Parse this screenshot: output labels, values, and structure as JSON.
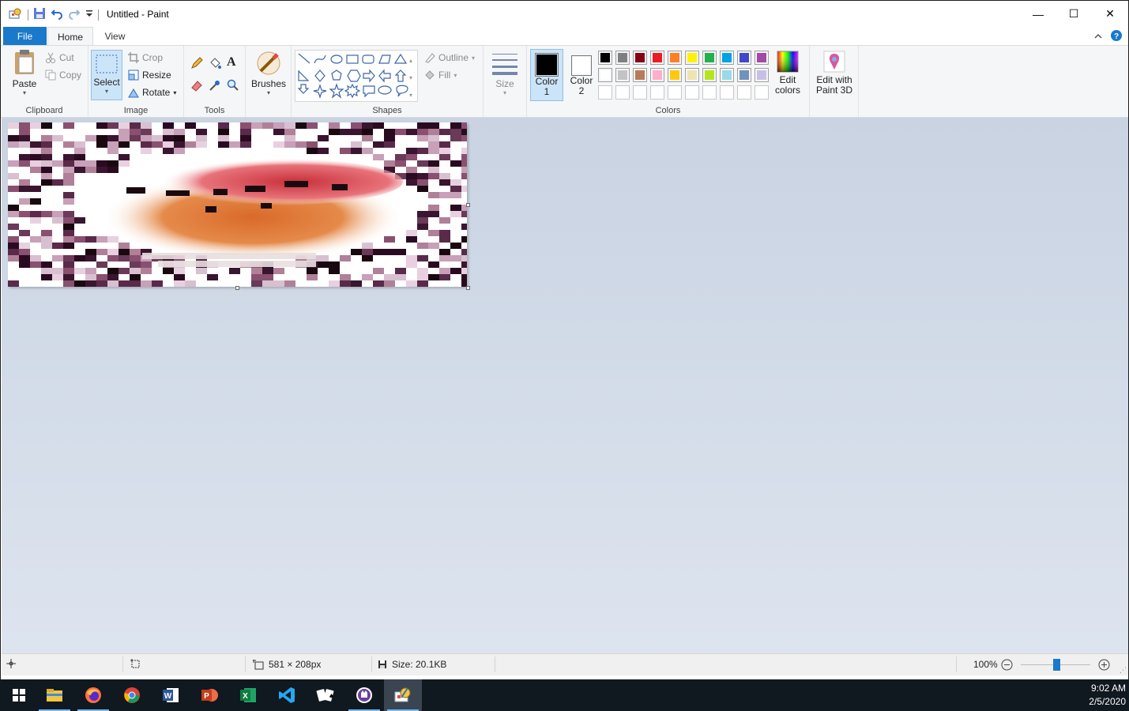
{
  "window": {
    "title": "Untitled - Paint",
    "minimize_glyph": "—",
    "maximize_glyph": "☐",
    "close_glyph": "✕"
  },
  "tabs": {
    "file": "File",
    "home": "Home",
    "view": "View"
  },
  "clipboard": {
    "paste": "Paste",
    "cut": "Cut",
    "copy": "Copy",
    "group": "Clipboard"
  },
  "image_group": {
    "select": "Select",
    "crop": "Crop",
    "resize": "Resize",
    "rotate": "Rotate",
    "group": "Image"
  },
  "tools": {
    "group": "Tools",
    "text_glyph": "A"
  },
  "brushes": {
    "label": "Brushes"
  },
  "shapes": {
    "outline": "Outline",
    "fill": "Fill",
    "group": "Shapes"
  },
  "size": {
    "label": "Size"
  },
  "colors": {
    "color1": "Color",
    "color1_num": "1",
    "color2": "Color",
    "color2_num": "2",
    "edit_colors_1": "Edit",
    "edit_colors_2": "colors",
    "edit_paint3d_1": "Edit with",
    "edit_paint3d_2": "Paint 3D",
    "group": "Colors",
    "primary": "#000000",
    "secondary": "#ffffff",
    "palette_row1": [
      "#000000",
      "#7f7f7f",
      "#880015",
      "#ed1c24",
      "#ff7f27",
      "#fff200",
      "#22b14c",
      "#00a2e8",
      "#3f48cc",
      "#a349a4"
    ],
    "palette_row2": [
      "#ffffff",
      "#c3c3c3",
      "#b97a57",
      "#ffaec9",
      "#ffc90e",
      "#efe4b0",
      "#b5e61d",
      "#99d9ea",
      "#7092be",
      "#c8bfe7"
    ]
  },
  "status": {
    "dimensions": "581 × 208px",
    "size": "Size: 20.1KB",
    "zoom": "100%",
    "zoom_level": 0.5
  },
  "clock": {
    "time": "9:02 AM",
    "date": "2/5/2020"
  },
  "taskbar_apps": [
    "start-icon",
    "file-explorer-icon",
    "firefox-icon",
    "chrome-icon",
    "word-icon",
    "powerpoint-icon",
    "excel-icon",
    "vscode-icon",
    "solitaire-icon",
    "app-icon",
    "paint-icon"
  ]
}
